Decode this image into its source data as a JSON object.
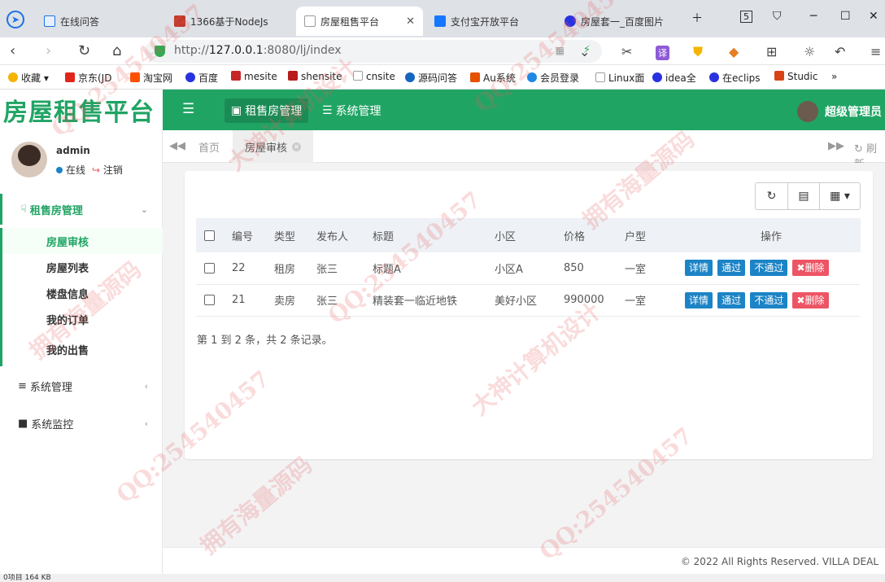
{
  "browser": {
    "tabs": [
      {
        "label": "在线问答",
        "color": "#1a73e8"
      },
      {
        "label": "1366基于NodeJs",
        "color": "#c0392b"
      },
      {
        "label": "房屋租售平台",
        "color": "#ffffff"
      },
      {
        "label": "支付宝开放平台",
        "color": "#1677ff"
      },
      {
        "label": "房屋套一_百度图片",
        "color": "#2932e1"
      }
    ],
    "url_prefix": "http://",
    "url_host": "127.0.0.1",
    "url_rest": ":8080/lj/index",
    "tab_count": "5",
    "bookmarks": [
      {
        "label": "收藏",
        "color": "#f4b400"
      },
      {
        "label": "京东(JD",
        "color": "#e1251b"
      },
      {
        "label": "淘宝网",
        "color": "#ff5000"
      },
      {
        "label": "百度",
        "color": "#2932e1"
      },
      {
        "label": "mesite",
        "color": "#c62828"
      },
      {
        "label": "shensite",
        "color": "#b71c1c"
      },
      {
        "label": "cnsite",
        "color": "#9e9e9e"
      },
      {
        "label": "源码问答",
        "color": "#1565c0"
      },
      {
        "label": "Au系统",
        "color": "#e65100"
      },
      {
        "label": "会员登录",
        "color": "#1e88e5"
      },
      {
        "label": "Linux面",
        "color": "#9e9e9e"
      },
      {
        "label": "idea全",
        "color": "#2932e1"
      },
      {
        "label": "在eclips",
        "color": "#2932e1"
      },
      {
        "label": "Studic",
        "color": "#d84315"
      }
    ]
  },
  "app": {
    "brand": "房屋租售平台",
    "top_nav": [
      "租售房管理",
      "系统管理"
    ],
    "admin_label": "超级管理员"
  },
  "sidebar": {
    "user_name": "admin",
    "status_online": "在线",
    "logout": "注销",
    "group_rent": "租售房管理",
    "items": [
      "房屋审核",
      "房屋列表",
      "楼盘信息",
      "我的订单",
      "我的出售"
    ],
    "group_system": "系统管理",
    "group_monitor": "系统监控"
  },
  "tabs": {
    "home": "首页",
    "current": "房屋审核",
    "refresh": "刷新"
  },
  "table": {
    "headers": [
      "编号",
      "类型",
      "发布人",
      "标题",
      "小区",
      "价格",
      "户型",
      "操作"
    ],
    "rows": [
      {
        "id": "22",
        "type": "租房",
        "publisher": "张三",
        "title": "标题A",
        "community": "小区A",
        "price": "850",
        "layout": "一室"
      },
      {
        "id": "21",
        "type": "卖房",
        "publisher": "张三",
        "title": "精装套一临近地铁",
        "community": "美好小区",
        "price": "990000",
        "layout": "一室"
      }
    ],
    "actions": {
      "detail": "详情",
      "pass": "通过",
      "reject": "不通过",
      "delete": "✖删除"
    },
    "page_info": "第 1 到 2 条，共 2 条记录。"
  },
  "footer": "© 2022 All Rights Reserved. VILLA DEAL",
  "statusbar": "0项目  164 KB",
  "watermarks": [
    "QQ:254540457",
    "拥有海量源码",
    "大神计算机设计"
  ]
}
